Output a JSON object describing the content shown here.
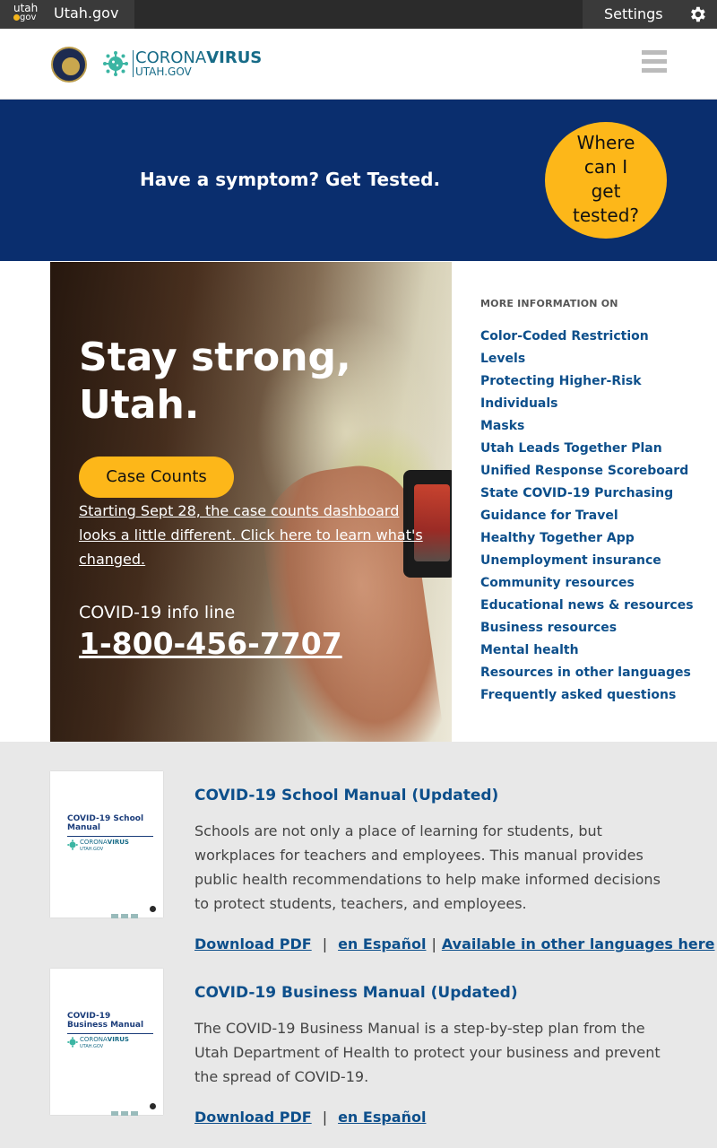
{
  "gov_bar": {
    "logo_top": "utah",
    "logo_bottom": "gov",
    "title": "Utah.gov",
    "settings_label": "Settings"
  },
  "header": {
    "brand_name_light": "CORONA",
    "brand_name_bold": "VIRUS",
    "brand_sub": "UTAH.GOV"
  },
  "test_banner": {
    "text": "Have a symptom? Get Tested.",
    "button_lines": [
      "Where",
      "can I",
      "get",
      "tested?"
    ]
  },
  "hero": {
    "title": "Stay strong, Utah.",
    "case_button": "Case Counts",
    "case_note": "Starting Sept 28, the case counts dashboard looks a little different. Click here to learn what's changed.",
    "info_label": "COVID-19 info line",
    "info_phone": "1-800-456-7707"
  },
  "more_info": {
    "heading": "MORE INFORMATION ON",
    "items": [
      "Color-Coded Restriction Levels",
      "Protecting Higher-Risk Individuals",
      "Masks",
      "Utah Leads Together Plan",
      "Unified Response Scoreboard",
      "State COVID-19 Purchasing",
      "Guidance for Travel",
      "Healthy Together App",
      "Unemployment insurance",
      "Community resources",
      "Educational news & resources",
      "Business resources",
      "Mental health",
      "Resources in other languages",
      "Frequently asked questions"
    ]
  },
  "manuals": [
    {
      "cover_title": "COVID-19 School Manual",
      "cover_brand_light": "CORONA",
      "cover_brand_bold": "VIRUS",
      "cover_brand_sub": "UTAH.GOV",
      "title": "COVID-19 School Manual (Updated)",
      "description": "Schools are not only a place of learning for students, but workplaces for teachers and employees. This manual provides public health recommendations to help make informed decisions to protect students, teachers, and employees.",
      "link_pdf": "Download PDF",
      "separator": "|",
      "link_spanish": "en Español",
      "link_other": "Available in other languages here"
    },
    {
      "cover_title": "COVID-19 Business Manual",
      "cover_brand_light": "CORONA",
      "cover_brand_bold": "VIRUS",
      "cover_brand_sub": "UTAH.GOV",
      "title": "COVID-19 Business Manual (Updated)",
      "description": "The COVID-19 Business Manual is a step-by-step plan from the Utah Department of Health to protect your business and prevent the spread of COVID-19.",
      "link_pdf": "Download PDF",
      "separator": "|",
      "link_spanish": "en Español"
    }
  ],
  "colors": {
    "banner_blue": "#0a2e6e",
    "accent_yellow": "#fdb719",
    "link_blue": "#0d4f8b",
    "brand_teal": "#176b87"
  }
}
